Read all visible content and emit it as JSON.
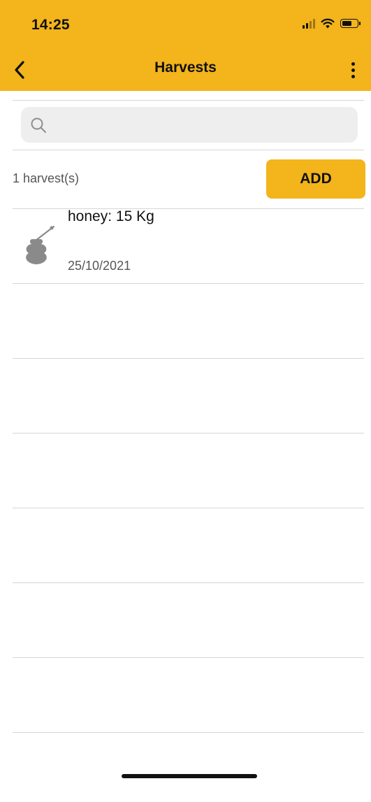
{
  "status_bar": {
    "time": "14:25"
  },
  "nav": {
    "title": "Harvests"
  },
  "search": {
    "placeholder": "",
    "value": ""
  },
  "summary": {
    "count_text": "1 harvest(s)",
    "add_label": "ADD"
  },
  "harvests": [
    {
      "title": "honey: 15 Kg",
      "date": "25/10/2021",
      "icon": "honey-pot-icon"
    }
  ],
  "colors": {
    "accent": "#f3b41c",
    "divider": "#d6d6d6",
    "search_bg": "#eeeeee",
    "icon_gray": "#8a8a8a"
  }
}
